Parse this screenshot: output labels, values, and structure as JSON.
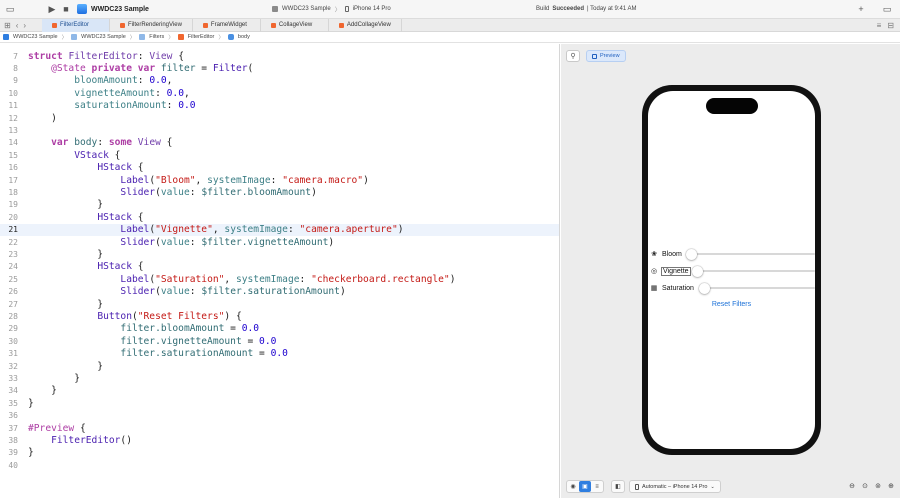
{
  "toolbar": {
    "project_title": "WWDC23 Sample",
    "scheme_name": "WWDC23 Sample",
    "scheme_sep": "〉",
    "device_name": "iPhone 14 Pro",
    "build_prefix": "Build",
    "build_status": "Succeeded",
    "build_time": "| Today at 9:41 AM"
  },
  "tabs": [
    {
      "label": "FilterEditor",
      "active": true
    },
    {
      "label": "FilterRenderingView"
    },
    {
      "label": "FrameWidget"
    },
    {
      "label": "CollageView"
    },
    {
      "label": "AddCollageView"
    }
  ],
  "breadcrumb": [
    "WWDC23 Sample",
    "WWDC23 Sample",
    "Filters",
    "FilterEditor",
    "body"
  ],
  "editor": {
    "highlighted_line": 21,
    "lines": [
      {
        "n": "7"
      },
      {
        "n": "8"
      },
      {
        "n": "9"
      },
      {
        "n": "10"
      },
      {
        "n": "11"
      },
      {
        "n": "12"
      },
      {
        "n": "13"
      },
      {
        "n": "14"
      },
      {
        "n": "15"
      },
      {
        "n": "16"
      },
      {
        "n": "17"
      },
      {
        "n": "18"
      },
      {
        "n": "19"
      },
      {
        "n": "20"
      },
      {
        "n": "21"
      },
      {
        "n": "22"
      },
      {
        "n": "23"
      },
      {
        "n": "24"
      },
      {
        "n": "25"
      },
      {
        "n": "26"
      },
      {
        "n": "27"
      },
      {
        "n": "28"
      },
      {
        "n": "29"
      },
      {
        "n": "30"
      },
      {
        "n": "31"
      },
      {
        "n": "32"
      },
      {
        "n": "33"
      },
      {
        "n": "34"
      },
      {
        "n": "35"
      },
      {
        "n": "36"
      },
      {
        "n": "37"
      },
      {
        "n": "38"
      },
      {
        "n": "39"
      },
      {
        "n": "40"
      }
    ],
    "tokens": {
      "struct_kw": "struct",
      "struct_name": "FilterEditor",
      "view_type": "View",
      "state_attr": "@State",
      "private_kw": "private",
      "var_kw": "var",
      "filter_id": "filter",
      "filter_type": "Filter",
      "bloom_param": "bloomAmount",
      "vignette_param": "vignetteAmount",
      "saturation_param": "saturationAmount",
      "zero": "0.0",
      "body_id": "body",
      "some_kw": "some",
      "vstack": "VStack",
      "hstack": "HStack",
      "label_fn": "Label",
      "slider_fn": "Slider",
      "button_fn": "Button",
      "bloom_str": "\"Bloom\"",
      "bloom_img": "\"camera.macro\"",
      "vignette_str": "\"Vignette\"",
      "vignette_img": "\"camera.aperture\"",
      "saturation_str": "\"Saturation\"",
      "saturation_img": "\"checkerboard.rectangle\"",
      "reset_str": "\"Reset Filters\"",
      "system_image": "systemImage",
      "value_param": "value",
      "binding_bloom": "$filter.bloomAmount",
      "binding_vignette": "$filter.vignetteAmount",
      "binding_saturation": "$filter.saturationAmount",
      "assign_bloom": "filter.bloomAmount",
      "assign_vignette": "filter.vignetteAmount",
      "assign_saturation": "filter.saturationAmount",
      "preview_macro": "#Preview",
      "preview_call": "FilterEditor"
    }
  },
  "canvas": {
    "preview_label": "Preview",
    "device_selector": "Automatic – iPhone 14 Pro",
    "controls": [
      {
        "label": "Bloom",
        "icon": "flower-icon",
        "glyph": "❀",
        "value": 0.0
      },
      {
        "label": "Vignette",
        "icon": "aperture-icon",
        "glyph": "◎",
        "value": 0.0
      },
      {
        "label": "Saturation",
        "icon": "checkerboard-icon",
        "glyph": "▦",
        "value": 0.0
      }
    ],
    "reset_label": "Reset Filters"
  },
  "colors": {
    "keyword": "#ad3da4",
    "type": "#703daa",
    "string": "#c41a16",
    "number": "#1c00cf",
    "accent": "#1d72d8"
  }
}
